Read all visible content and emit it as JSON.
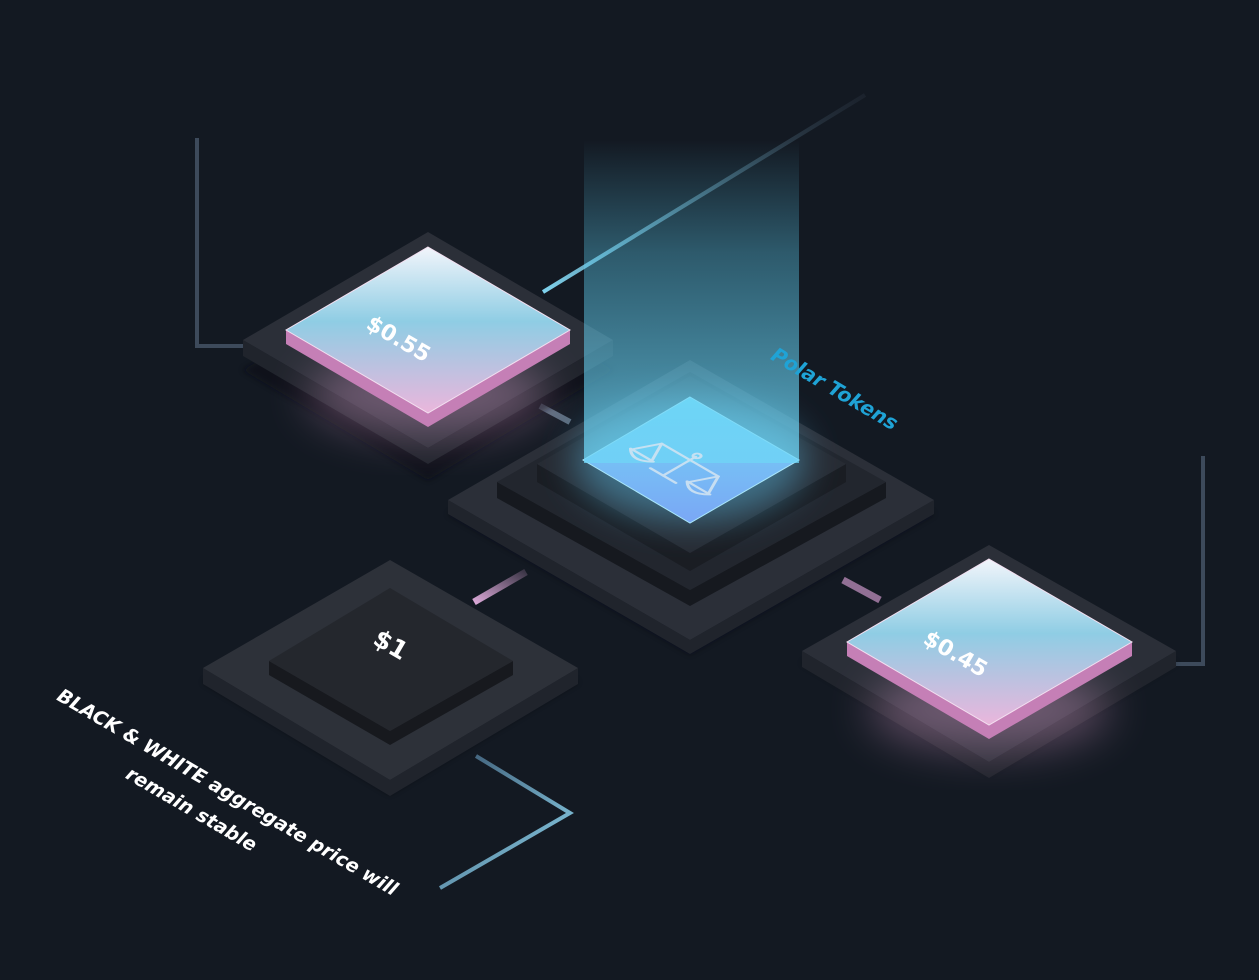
{
  "tiles": {
    "left": {
      "price": "$0.55"
    },
    "right": {
      "price": "$0.45"
    },
    "bottom": {
      "price": "$1"
    }
  },
  "center": {
    "label": "Polar Tokens",
    "icon": "balance-scale-icon"
  },
  "caption": {
    "line1": "BLACK & WHITE aggregate price will",
    "line2": "remain stable"
  },
  "colors": {
    "background": "#131922",
    "accent_blue": "#1fa3d6",
    "tile_pink": "#e9b3dd",
    "tile_cyan": "#7fc9e3",
    "platform": "#2b2f38"
  }
}
